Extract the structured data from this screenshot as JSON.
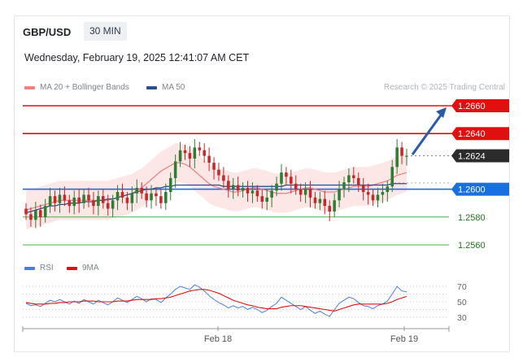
{
  "header": {
    "pair": "GBP/USD",
    "timeframe": "30 MIN",
    "datetime": "Wednesday, February 19, 2025 12:41:07 AM CET",
    "credit": "Research © 2025 Trading Central"
  },
  "legend": {
    "ma20_label": "MA 20 + Bollinger Bands",
    "ma50_label": "MA 50",
    "rsi_label": "RSI",
    "ma9_label": "9MA"
  },
  "colors": {
    "ma20": "#f08080",
    "ma50": "#2c4f8a",
    "resistance": "#e01010",
    "support": "#1a6fe0",
    "target": "#4caf50",
    "current": "#2b2b2b",
    "arrow": "#2a5ca8",
    "rsi": "#4a7fe0",
    "rsi9": "#e01010"
  },
  "levels": [
    {
      "value": "1.2660",
      "type": "resistance"
    },
    {
      "value": "1.2640",
      "type": "resistance"
    },
    {
      "value": "1.2624",
      "type": "current"
    },
    {
      "value": "1.2600",
      "type": "pivot"
    },
    {
      "value": "1.2580",
      "type": "support"
    },
    {
      "value": "1.2560",
      "type": "support"
    }
  ],
  "rsi_axis": [
    "70",
    "50",
    "30"
  ],
  "x_axis": [
    "Feb 18",
    "Feb 19"
  ],
  "chart_data": {
    "type": "candlestick",
    "ylim": [
      1.2555,
      1.267
    ],
    "closes": [
      1.2582,
      1.2578,
      1.2585,
      1.258,
      1.2588,
      1.2595,
      1.259,
      1.2596,
      1.2592,
      1.2588,
      1.2594,
      1.259,
      1.2596,
      1.2592,
      1.2588,
      1.2595,
      1.259,
      1.2586,
      1.2592,
      1.2598,
      1.2594,
      1.259,
      1.2597,
      1.2601,
      1.2597,
      1.2592,
      1.2597,
      1.2595,
      1.259,
      1.2598,
      1.2608,
      1.262,
      1.2628,
      1.2626,
      1.2622,
      1.263,
      1.2628,
      1.2624,
      1.2619,
      1.2614,
      1.261,
      1.2606,
      1.26,
      1.2603,
      1.2599,
      1.2601,
      1.2597,
      1.2599,
      1.2595,
      1.2591,
      1.2594,
      1.2599,
      1.2604,
      1.2612,
      1.2609,
      1.2604,
      1.26,
      1.2596,
      1.26,
      1.2594,
      1.259,
      1.2593,
      1.2588,
      1.2584,
      1.2592,
      1.26,
      1.2605,
      1.261,
      1.2608,
      1.2603,
      1.2598,
      1.2596,
      1.2592,
      1.2596,
      1.2598,
      1.2602,
      1.2616,
      1.263,
      1.2624,
      1.2624
    ],
    "ma20": [
      1.2585,
      1.2586,
      1.2587,
      1.2588,
      1.2589,
      1.259,
      1.2591,
      1.2592,
      1.2592,
      1.2592,
      1.2592,
      1.2592,
      1.2592,
      1.2592,
      1.2592,
      1.2592,
      1.2592,
      1.2592,
      1.2593,
      1.2594,
      1.2595,
      1.2596,
      1.2597,
      1.2599,
      1.2601,
      1.2604,
      1.2607,
      1.261,
      1.2613,
      1.2615,
      1.2617,
      1.2619,
      1.2619,
      1.2618,
      1.2616,
      1.2613,
      1.261,
      1.2607,
      1.2604,
      1.2602,
      1.2601,
      1.26,
      1.2599,
      1.2598,
      1.2598,
      1.2599,
      1.26,
      1.2601,
      1.2601,
      1.26,
      1.2599,
      1.2598,
      1.2597,
      1.2597,
      1.2597,
      1.2598,
      1.2599,
      1.26,
      1.2601,
      1.2601,
      1.26,
      1.2599,
      1.2598,
      1.2598,
      1.2598,
      1.2599,
      1.26,
      1.2601,
      1.2602,
      1.2602,
      1.2602,
      1.2602,
      1.2603,
      1.2604,
      1.2605,
      1.2606,
      1.2608,
      1.261,
      1.2611,
      1.2612
    ],
    "ma50": [
      1.2583,
      1.2584,
      1.2585,
      1.2586,
      1.2587,
      1.2588,
      1.2588,
      1.2589,
      1.2589,
      1.259,
      1.259,
      1.259,
      1.2591,
      1.2591,
      1.2591,
      1.2592,
      1.2592,
      1.2593,
      1.2593,
      1.2594,
      1.2595,
      1.2596,
      1.2597,
      1.2598,
      1.2599,
      1.26,
      1.26,
      1.2601,
      1.2601,
      1.2602,
      1.2602,
      1.2603,
      1.2603,
      1.2603,
      1.2603,
      1.2603,
      1.2603,
      1.2603,
      1.2603,
      1.2603,
      1.2603,
      1.2602,
      1.2602,
      1.2602,
      1.2602,
      1.2602,
      1.2602,
      1.2602,
      1.2602,
      1.2602,
      1.2602,
      1.2602,
      1.2602,
      1.2602,
      1.2603,
      1.2603,
      1.2603,
      1.2603,
      1.2603,
      1.2603,
      1.2603,
      1.2603,
      1.2603,
      1.2603,
      1.2603,
      1.2603,
      1.2603,
      1.2603,
      1.2603,
      1.2603,
      1.2603,
      1.2603,
      1.2603,
      1.2603,
      1.2603,
      1.2603,
      1.2604,
      1.2604,
      1.2604,
      1.2604
    ],
    "band_width": 0.0014,
    "rsi": [
      48,
      45,
      46,
      44,
      48,
      52,
      50,
      53,
      50,
      47,
      51,
      48,
      53,
      50,
      47,
      52,
      49,
      46,
      50,
      55,
      52,
      49,
      53,
      57,
      54,
      50,
      54,
      53,
      49,
      55,
      60,
      66,
      70,
      68,
      66,
      72,
      69,
      64,
      58,
      53,
      49,
      46,
      42,
      45,
      42,
      44,
      40,
      43,
      40,
      36,
      39,
      44,
      48,
      56,
      52,
      48,
      44,
      40,
      44,
      39,
      35,
      38,
      34,
      31,
      40,
      48,
      52,
      56,
      54,
      49,
      45,
      44,
      41,
      45,
      47,
      51,
      60,
      70,
      64,
      63
    ],
    "rsi9": [
      49,
      48,
      47,
      47,
      47,
      48,
      48,
      49,
      49,
      50,
      50,
      50,
      51,
      51,
      51,
      50,
      50,
      50,
      50,
      51,
      51,
      51,
      52,
      53,
      53,
      53,
      53,
      54,
      54,
      55,
      56,
      58,
      60,
      62,
      64,
      65,
      66,
      66,
      65,
      63,
      61,
      58,
      55,
      52,
      50,
      48,
      46,
      45,
      43,
      42,
      41,
      41,
      41,
      43,
      44,
      45,
      45,
      45,
      44,
      43,
      42,
      41,
      40,
      39,
      38,
      40,
      42,
      44,
      46,
      47,
      47,
      47,
      47,
      47,
      47,
      48,
      50,
      53,
      55,
      57
    ],
    "rsi_ylim": [
      25,
      78
    ]
  }
}
